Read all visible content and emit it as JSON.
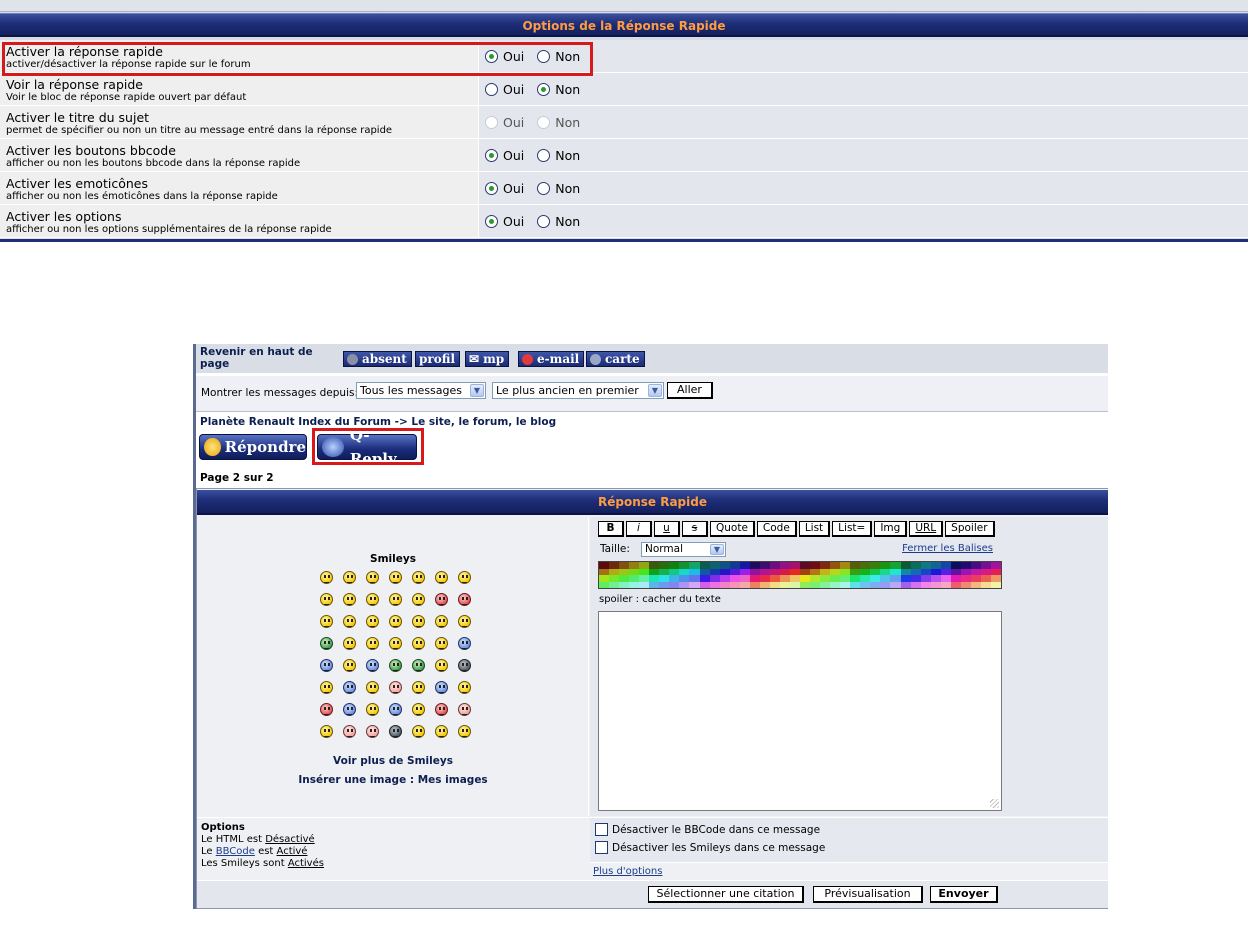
{
  "options_panel": {
    "header": "Options de la Réponse Rapide",
    "rows": [
      {
        "title": "Activer la réponse rapide",
        "desc": "activer/désactiver la réponse rapide sur le forum",
        "yes": "Oui",
        "no": "Non",
        "selected": "Oui",
        "disabled": false
      },
      {
        "title": "Voir la réponse rapide",
        "desc": "Voir le bloc de réponse rapide ouvert par défaut",
        "yes": "Oui",
        "no": "Non",
        "selected": "Non",
        "disabled": false
      },
      {
        "title": "Activer le titre du sujet",
        "desc": "permet de spécifier ou non un titre au message entré dans la réponse rapide",
        "yes": "Oui",
        "no": "Non",
        "selected": "",
        "disabled": true
      },
      {
        "title": "Activer les boutons bbcode",
        "desc": "afficher ou non les boutons bbcode dans la réponse rapide",
        "yes": "Oui",
        "no": "Non",
        "selected": "Oui",
        "disabled": false
      },
      {
        "title": "Activer les emoticônes",
        "desc": "afficher ou non les émoticônes dans la réponse rapide",
        "yes": "Oui",
        "no": "Non",
        "selected": "Oui",
        "disabled": false
      },
      {
        "title": "Activer les options",
        "desc": "afficher ou non les options supplémentaires de la réponse rapide",
        "yes": "Oui",
        "no": "Non",
        "selected": "Oui",
        "disabled": false
      }
    ]
  },
  "forum": {
    "back_to_top": "Revenir en haut de page",
    "profile_buttons": [
      "absent",
      "profil",
      "mp",
      "e-mail",
      "carte"
    ],
    "filter_label": "Montrer les messages depuis:",
    "filter_since": "Tous les messages",
    "filter_order": "Le plus ancien en premier",
    "go_button": "Aller",
    "breadcrumb": "Planète Renault Index du Forum -> Le site, le forum, le blog",
    "reply_button": "Répondre",
    "qreply_button": "Q-Reply",
    "page_info": "Page 2 sur 2",
    "qr_header": "Réponse Rapide",
    "smileys_title": "Smileys",
    "more_smileys": "Voir plus de Smileys",
    "insert_image": "Insérer une image : Mes images",
    "bbcode_buttons": [
      "B",
      "i",
      "u",
      "s",
      "Quote",
      "Code",
      "List",
      "List=",
      "Img",
      "URL",
      "Spoiler"
    ],
    "size_label": "Taille:",
    "size_value": "Normal",
    "close_tags": "Fermer les Balises",
    "spoiler_note": "spoiler : cacher du texte",
    "options_title": "Options",
    "html_prefix": "Le HTML est ",
    "html_state": "Désactivé",
    "bbcode_prefix": "Le ",
    "bbcode_link": "BBCode",
    "bbcode_mid": " est ",
    "bbcode_state": "Activé",
    "smileys_prefix": "Les Smileys sont ",
    "smileys_state": "Activés",
    "disable_bbcode": "Désactiver le BBCode dans ce message",
    "disable_smileys": "Désactiver les Smileys dans ce message",
    "more_options": "Plus d'options",
    "btn_quote": "Sélectionner une citation",
    "btn_preview": "Prévisualisation",
    "btn_send": "Envoyer"
  },
  "colors": {
    "header_text": "#ff9c42",
    "header_bg": "#1e2e78",
    "highlight": "#d7191c",
    "radio_dot": "#2a9a2a"
  }
}
